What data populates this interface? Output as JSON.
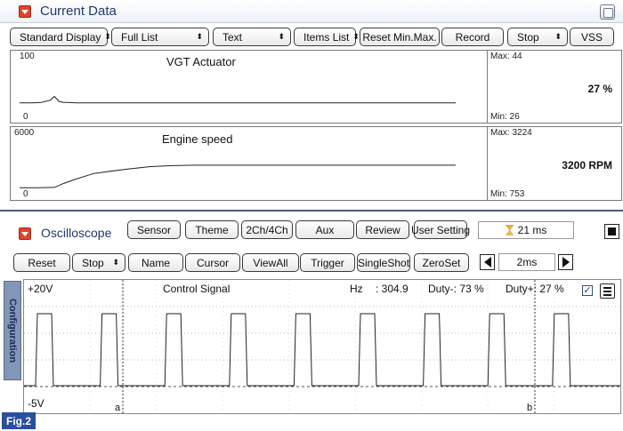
{
  "current_data": {
    "title": "Current Data",
    "toolbar": [
      {
        "name": "display-select",
        "label": "Standard Display",
        "sort": true
      },
      {
        "name": "list-select",
        "label": "Full List",
        "sort": true
      },
      {
        "name": "view-select",
        "label": "Text",
        "sort": true
      },
      {
        "name": "items-list-select",
        "label": "Items List",
        "sort": true
      },
      {
        "name": "reset-minmax-button",
        "label": "Reset Min.Max.",
        "sort": false
      },
      {
        "name": "record-button",
        "label": "Record",
        "sort": false
      },
      {
        "name": "stop-select",
        "label": "Stop",
        "sort": true
      },
      {
        "name": "vss-button",
        "label": "VSS",
        "sort": false
      }
    ],
    "graphs": [
      {
        "name": "VGT Actuator",
        "scale_max": "100",
        "scale_min": "0",
        "max_label": "Max: 44",
        "min_label": "Min: 26",
        "value": "27 %",
        "trace": {
          "x": [
            0,
            3,
            5,
            7,
            8,
            9,
            10,
            11,
            13,
            20,
            40,
            60,
            100
          ],
          "y": [
            27,
            27,
            28,
            32,
            39,
            30,
            28,
            28,
            27,
            27,
            27,
            27,
            27
          ]
        }
      },
      {
        "name": "Engine speed",
        "scale_max": "6000",
        "scale_min": "0",
        "max_label": "Max: 3224",
        "min_label": "Min: 753",
        "value": "3200 RPM",
        "trace": {
          "x": [
            0,
            4,
            8,
            10,
            13,
            15,
            17,
            20,
            25,
            30,
            35,
            40,
            50,
            100
          ],
          "y": [
            753,
            753,
            780,
            1200,
            1700,
            2000,
            2300,
            2500,
            2800,
            3050,
            3150,
            3200,
            3200,
            3200
          ]
        }
      }
    ]
  },
  "oscilloscope": {
    "title": "Oscilloscope",
    "row1": [
      {
        "name": "sensor-button",
        "label": "Sensor"
      },
      {
        "name": "theme-button",
        "label": "Theme"
      },
      {
        "name": "channel-mode-button",
        "label": "2Ch/4Ch"
      },
      {
        "name": "aux-button",
        "label": "Aux"
      },
      {
        "name": "review-button",
        "label": "Review"
      },
      {
        "name": "user-setting-button",
        "label": "User Setting"
      }
    ],
    "timer": "21 ms",
    "row2": [
      {
        "name": "reset-button",
        "label": "Reset",
        "sort": false
      },
      {
        "name": "stop-select",
        "label": "Stop",
        "sort": true
      },
      {
        "name": "name-button",
        "label": "Name",
        "sort": false
      },
      {
        "name": "cursor-button",
        "label": "Cursor",
        "sort": false
      },
      {
        "name": "view-all-button",
        "label": "ViewAll",
        "sort": false
      },
      {
        "name": "trigger-button",
        "label": "Trigger",
        "sort": false
      },
      {
        "name": "single-shot-button",
        "label": "SingleShot",
        "sort": false
      },
      {
        "name": "zero-set-button",
        "label": "ZeroSet",
        "sort": false
      }
    ],
    "timebase": "2ms",
    "side_tab": "Configuration",
    "scope": {
      "top_label": "+20V",
      "bottom_label": "-5V",
      "signal_name": "Control Signal",
      "hz_label": "Hz",
      "hz_value": ": 304.9",
      "duty_minus_label": "Duty-: 73 %",
      "duty_plus_label": "Duty+: 27 %",
      "cursor_a": "a",
      "cursor_b": "b",
      "pulse_count": 9
    }
  },
  "figure_label": "Fig.2"
}
